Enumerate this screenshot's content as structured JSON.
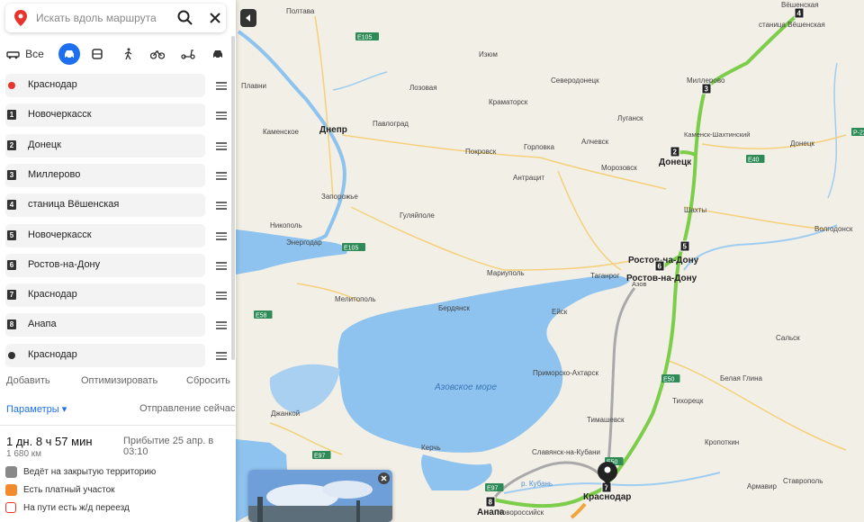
{
  "search": {
    "placeholder": "Искать вдоль маршрута"
  },
  "modes": [
    {
      "icon": "car-all-icon",
      "label": "Все"
    },
    {
      "icon": "car-icon",
      "label": ""
    },
    {
      "icon": "bus-icon",
      "label": ""
    },
    {
      "icon": "walk-icon",
      "label": ""
    },
    {
      "icon": "bicycle-icon",
      "label": ""
    },
    {
      "icon": "scooter-icon",
      "label": ""
    },
    {
      "icon": "taxi-icon",
      "label": ""
    }
  ],
  "waypoints": [
    {
      "marker": "",
      "label": "Краснодар"
    },
    {
      "marker": "1",
      "label": "Новочеркасск"
    },
    {
      "marker": "2",
      "label": "Донецк"
    },
    {
      "marker": "3",
      "label": "Миллерово"
    },
    {
      "marker": "4",
      "label": "станица Вёшенская"
    },
    {
      "marker": "5",
      "label": "Новочеркасск"
    },
    {
      "marker": "6",
      "label": "Ростов-на-Дону"
    },
    {
      "marker": "7",
      "label": "Краснодар"
    },
    {
      "marker": "8",
      "label": "Анапа"
    },
    {
      "marker": "",
      "label": "Краснодар"
    }
  ],
  "actions": {
    "add": "Добавить",
    "optimize": "Оптимизировать",
    "reset": "Сбросить"
  },
  "params": {
    "label": "Параметры ▾",
    "departure": "Отправление сейчас"
  },
  "summary": {
    "duration": "1 дн. 8 ч 57 мин",
    "arrival": "Прибытие 25 апр. в 03:10",
    "distance": "1 680 км"
  },
  "warnings": [
    {
      "icon": "restricted-area-icon",
      "text": "Ведёт на закрытую территорию"
    },
    {
      "icon": "toll-road-icon",
      "text": "Есть платный участок"
    },
    {
      "icon": "railway-crossing-icon",
      "text": "На пути есть ж/д переезд"
    }
  ],
  "colors": {
    "accent": "#1e6ff0",
    "route": "#7ccd4a",
    "alt_route": "#a9a9a9",
    "sea": "#8ec3ef",
    "land": "#f2efe6",
    "start": "#e8352b"
  },
  "map": {
    "sea_name": "Азовское море",
    "cities": [
      "Полтава",
      "Вёшенская",
      "станица Вёшенская",
      "Изюм",
      "Северодонецк",
      "Миллерово",
      "Лозовая",
      "Краматорск",
      "Луганск",
      "Днепр",
      "Павлоград",
      "Каменское",
      "Покровск",
      "Горловка",
      "Алчевск",
      "Каменск-Шахтинский",
      "Донецк",
      "Морозовск",
      "Антрацит",
      "Донецк",
      "Запорожье",
      "Гуляйполе",
      "Шахты",
      "Никополь",
      "Энергодар",
      "Ростов-на-Дону",
      "Ростов-на-Дону",
      "Волгодонск",
      "Мариуполь",
      "Таганрог",
      "Азов",
      "Мелитополь",
      "Бердянск",
      "Ейск",
      "Сальск",
      "Приморско-Ахтарск",
      "Белая Глина",
      "Тихорецк",
      "Джанкой",
      "Тимашевск",
      "Керчь",
      "Кропоткин",
      "Славянск-на-Кубани",
      "Краснодар",
      "Армавир",
      "Анапа",
      "Новороссийск",
      "Ставрополь",
      "Плавни",
      "р. Кубань"
    ],
    "roads": [
      "E105",
      "E105",
      "E40",
      "E50",
      "E58",
      "E97",
      "E97",
      "E50",
      "P-22"
    ]
  }
}
